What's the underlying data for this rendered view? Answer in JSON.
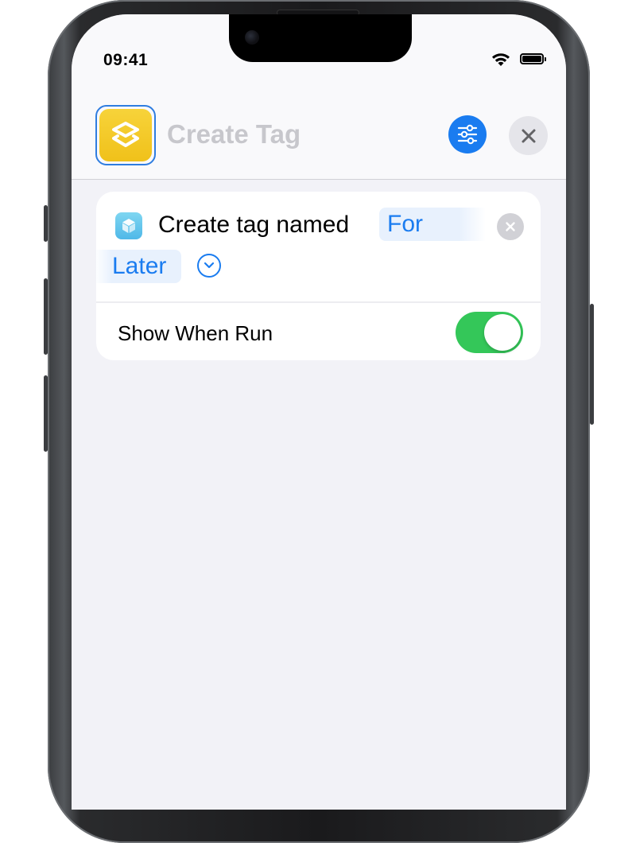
{
  "status_bar": {
    "time": "09:41",
    "icons": [
      "wifi-icon",
      "battery-icon"
    ]
  },
  "header": {
    "app_icon": "shortcuts-icon",
    "title": "Create Tag",
    "settings_button": "settings-sliders-icon",
    "close_button": "close-icon"
  },
  "action": {
    "icon": "tag-app-icon",
    "label": "Create tag named",
    "parameter_part1": "For",
    "parameter_part2": "Later",
    "clear_icon": "clear-icon",
    "expand_icon": "chevron-down-icon"
  },
  "options": {
    "show_when_run_label": "Show When Run",
    "show_when_run_enabled": true
  },
  "colors": {
    "accent": "#1a7cf0",
    "toggle_on": "#34c759",
    "app_icon_yellow": "#f0c11a",
    "background": "#f2f2f7"
  }
}
